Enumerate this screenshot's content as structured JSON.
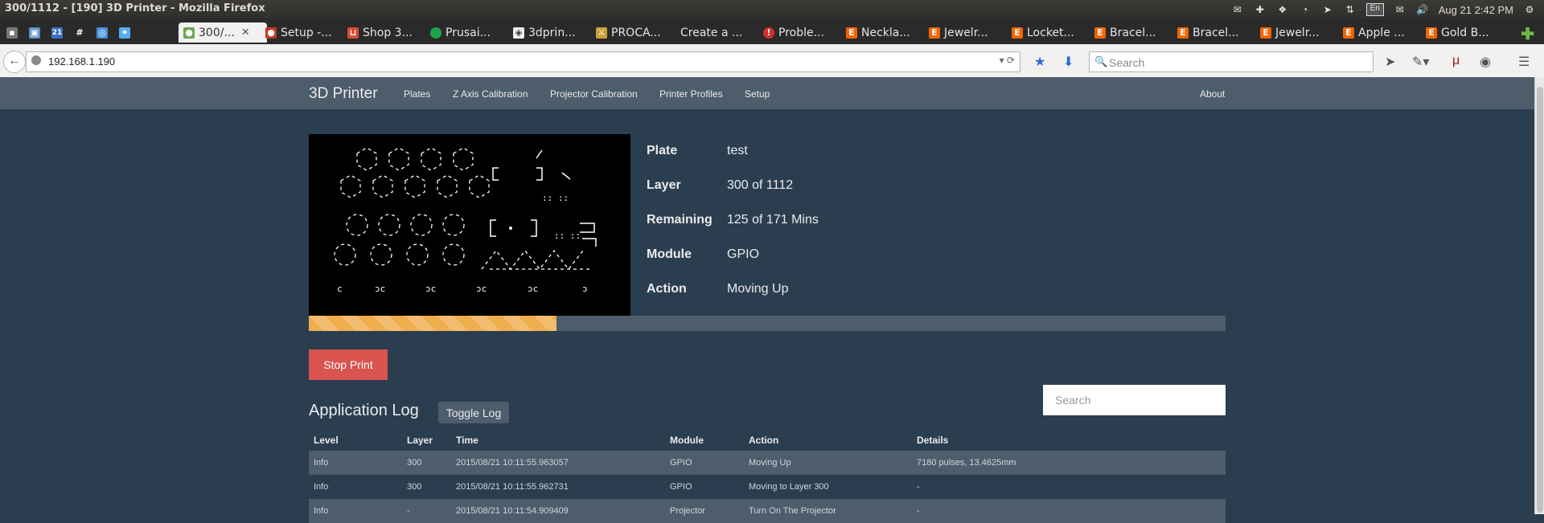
{
  "os": {
    "window_title": "300/1112 - [190] 3D Printer - Mozilla Firefox",
    "keyboard_layout": "En",
    "clock": "Aug 21  2:42 PM"
  },
  "tabs": [
    {
      "label": "300/...",
      "active": true
    },
    {
      "label": "Setup -..."
    },
    {
      "label": "Shop 3..."
    },
    {
      "label": "Prusai..."
    },
    {
      "label": "3dprin..."
    },
    {
      "label": "PROCA..."
    },
    {
      "label": "Create a ..."
    },
    {
      "label": "Proble..."
    },
    {
      "label": "Neckla..."
    },
    {
      "label": "Jewelr..."
    },
    {
      "label": "Locket..."
    },
    {
      "label": "Bracel..."
    },
    {
      "label": "Bracel..."
    },
    {
      "label": "Jewelr..."
    },
    {
      "label": "Apple ..."
    },
    {
      "label": "Gold B..."
    }
  ],
  "pinned_tabs": [
    "21",
    "#"
  ],
  "address": "192.168.1.190",
  "browser_search_placeholder": "Search",
  "app": {
    "brand": "3D Printer",
    "nav": [
      "Plates",
      "Z Axis Calibration",
      "Projector Calibration",
      "Printer Profiles",
      "Setup"
    ],
    "about": "About"
  },
  "job": {
    "labels": {
      "plate": "Plate",
      "layer": "Layer",
      "remaining": "Remaining",
      "module": "Module",
      "action": "Action"
    },
    "plate": "test",
    "layer": "300 of 1112",
    "remaining": "125 of 171 Mins",
    "module": "GPIO",
    "action": "Moving Up",
    "progress_fraction": 0.27
  },
  "stop_button": "Stop Print",
  "log": {
    "title": "Application Log",
    "toggle_button": "Toggle Log",
    "search_placeholder": "Search",
    "columns": [
      "Level",
      "Layer",
      "Time",
      "Module",
      "Action",
      "Details"
    ],
    "rows": [
      [
        "Info",
        "300",
        "2015/08/21 10:11:55.963057",
        "GPIO",
        "Moving Up",
        "7180 pulses, 13.4625mm"
      ],
      [
        "Info",
        "300",
        "2015/08/21 10:11:55.962731",
        "GPIO",
        "Moving to Layer 300",
        "-"
      ],
      [
        "Info",
        "-",
        "2015/08/21 10:11:54.909409",
        "Projector",
        "Turn On The Projector",
        "-"
      ]
    ]
  },
  "colors": {
    "background": "#2b3e50",
    "navbar": "#4e5d6c",
    "danger": "#d9534f",
    "progress": "#f0ad4e"
  }
}
